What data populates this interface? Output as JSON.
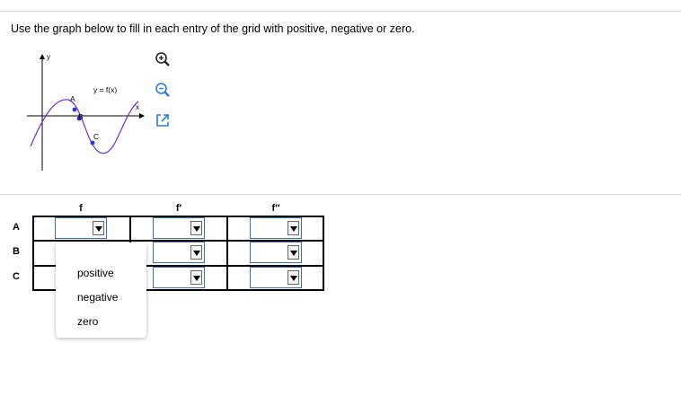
{
  "instruction": "Use the graph below to fill in each entry of the grid with positive, negative or zero.",
  "graph": {
    "function_label": "y = f(x)",
    "x_axis_label": "x",
    "y_axis_label": "y",
    "points": [
      "A",
      "B",
      "C"
    ],
    "curve_color": "#6a2bd6",
    "point_color": "#2b34d6"
  },
  "icons": {
    "zoom_in": "zoom-in-icon",
    "zoom_out": "zoom-out-icon",
    "popout": "popout-icon"
  },
  "grid": {
    "columns": [
      "f",
      "f′",
      "f′′"
    ],
    "rows": [
      "A",
      "B",
      "C"
    ]
  },
  "dropdown": {
    "options": [
      "positive",
      "negative",
      "zero"
    ]
  },
  "colors": {
    "select_border": "#3d6db5",
    "divider": "#d8d8d8"
  }
}
